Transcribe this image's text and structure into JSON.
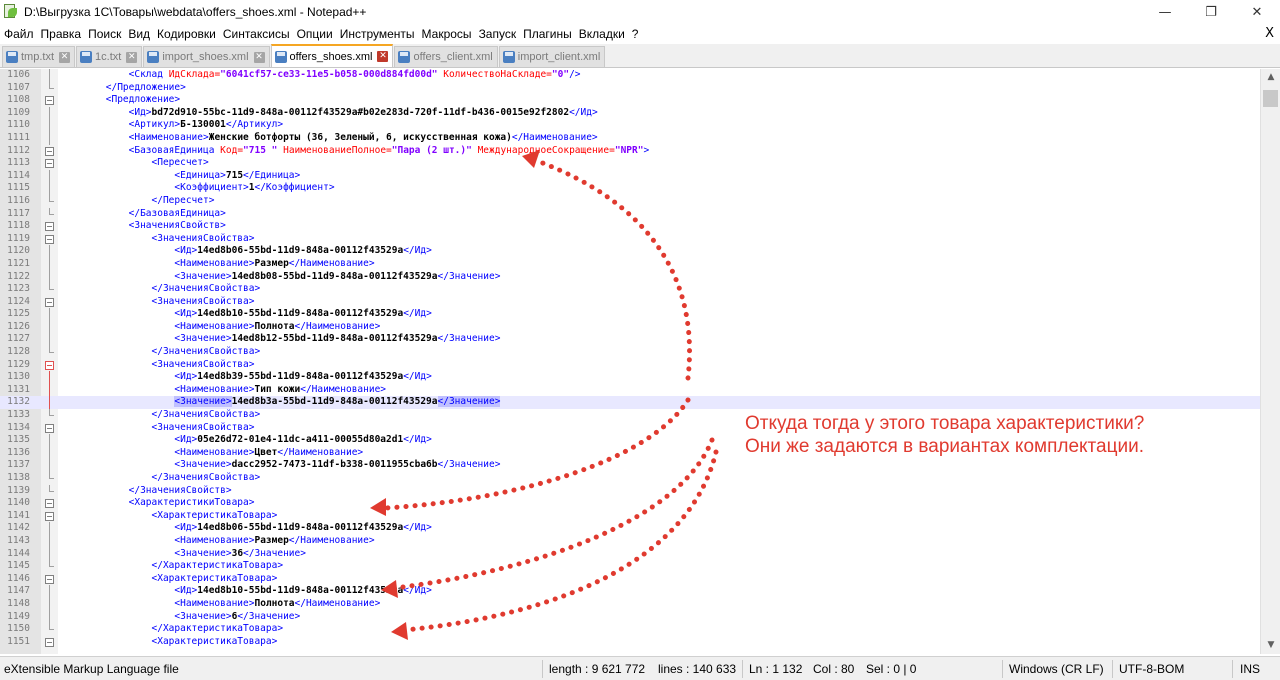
{
  "window": {
    "title": "D:\\Выгрузка 1С\\Товары\\webdata\\offers_shoes.xml - Notepad++",
    "minimize": "—",
    "maximize": "❐",
    "close": "✕"
  },
  "menu": {
    "items": [
      "Файл",
      "Правка",
      "Поиск",
      "Вид",
      "Кодировки",
      "Синтаксисы",
      "Опции",
      "Инструменты",
      "Макросы",
      "Запуск",
      "Плагины",
      "Вкладки",
      "?"
    ],
    "close": "X"
  },
  "tabs": [
    {
      "label": "tmp.txt",
      "active": false
    },
    {
      "label": "1c.txt",
      "active": false
    },
    {
      "label": "import_shoes.xml",
      "active": false
    },
    {
      "label": "offers_shoes.xml",
      "active": true
    },
    {
      "label": "offers_client.xml",
      "active": false
    },
    {
      "label": "import_client.xml",
      "active": false
    }
  ],
  "editor": {
    "current_line": 1132,
    "lines": [
      {
        "n": "1106",
        "indent": 6,
        "parts": [
          [
            "tag",
            "<Склад "
          ],
          [
            "attr",
            "ИдСклада="
          ],
          [
            "val",
            "\"6041cf57-ce33-11e5-b058-000d884fd00d\""
          ],
          [
            "attr",
            " КоличествоНаСкладе="
          ],
          [
            "val",
            "\"0\""
          ],
          [
            "tag",
            "/>"
          ]
        ]
      },
      {
        "n": "1107",
        "indent": 4,
        "parts": [
          [
            "tag",
            "</Предложение>"
          ]
        ]
      },
      {
        "n": "1108",
        "indent": 4,
        "parts": [
          [
            "tag",
            "<Предложение>"
          ]
        ]
      },
      {
        "n": "1109",
        "indent": 6,
        "parts": [
          [
            "tag",
            "<Ид>"
          ],
          [
            "txt",
            "bd72d910-55bc-11d9-848a-00112f43529a#b02e283d-720f-11df-b436-0015e92f2802"
          ],
          [
            "tag",
            "</Ид>"
          ]
        ]
      },
      {
        "n": "1110",
        "indent": 6,
        "parts": [
          [
            "tag",
            "<Артикул>"
          ],
          [
            "txt",
            "Б-130001"
          ],
          [
            "tag",
            "</Артикул>"
          ]
        ]
      },
      {
        "n": "1111",
        "indent": 6,
        "parts": [
          [
            "tag",
            "<Наименование>"
          ],
          [
            "txt",
            "Женские ботфорты (36, Зеленый, 6, искусственная кожа)"
          ],
          [
            "tag",
            "</Наименование>"
          ]
        ]
      },
      {
        "n": "1112",
        "indent": 6,
        "parts": [
          [
            "tag",
            "<БазоваяЕдиница "
          ],
          [
            "attr",
            "Код="
          ],
          [
            "val",
            "\"715 \""
          ],
          [
            "attr",
            " НаименованиеПолное="
          ],
          [
            "val",
            "\"Пара (2 шт.)\""
          ],
          [
            "attr",
            " МеждународноеСокращение="
          ],
          [
            "val",
            "\"NPR\""
          ],
          [
            "tag",
            ">"
          ]
        ]
      },
      {
        "n": "1113",
        "indent": 8,
        "parts": [
          [
            "tag",
            "<Пересчет>"
          ]
        ]
      },
      {
        "n": "1114",
        "indent": 10,
        "parts": [
          [
            "tag",
            "<Единица>"
          ],
          [
            "txt",
            "715"
          ],
          [
            "tag",
            "</Единица>"
          ]
        ]
      },
      {
        "n": "1115",
        "indent": 10,
        "parts": [
          [
            "tag",
            "<Коэффициент>"
          ],
          [
            "txt",
            "1"
          ],
          [
            "tag",
            "</Коэффициент>"
          ]
        ]
      },
      {
        "n": "1116",
        "indent": 8,
        "parts": [
          [
            "tag",
            "</Пересчет>"
          ]
        ]
      },
      {
        "n": "1117",
        "indent": 6,
        "parts": [
          [
            "tag",
            "</БазоваяЕдиница>"
          ]
        ]
      },
      {
        "n": "1118",
        "indent": 6,
        "parts": [
          [
            "tag",
            "<ЗначенияСвойств>"
          ]
        ]
      },
      {
        "n": "1119",
        "indent": 8,
        "parts": [
          [
            "tag",
            "<ЗначенияСвойства>"
          ]
        ]
      },
      {
        "n": "1120",
        "indent": 10,
        "parts": [
          [
            "tag",
            "<Ид>"
          ],
          [
            "txt",
            "14ed8b06-55bd-11d9-848a-00112f43529a"
          ],
          [
            "tag",
            "</Ид>"
          ]
        ]
      },
      {
        "n": "1121",
        "indent": 10,
        "parts": [
          [
            "tag",
            "<Наименование>"
          ],
          [
            "txt",
            "Размер"
          ],
          [
            "tag",
            "</Наименование>"
          ]
        ]
      },
      {
        "n": "1122",
        "indent": 10,
        "parts": [
          [
            "tag",
            "<Значение>"
          ],
          [
            "txt",
            "14ed8b08-55bd-11d9-848a-00112f43529a"
          ],
          [
            "tag",
            "</Значение>"
          ]
        ]
      },
      {
        "n": "1123",
        "indent": 8,
        "parts": [
          [
            "tag",
            "</ЗначенияСвойства>"
          ]
        ]
      },
      {
        "n": "1124",
        "indent": 8,
        "parts": [
          [
            "tag",
            "<ЗначенияСвойства>"
          ]
        ]
      },
      {
        "n": "1125",
        "indent": 10,
        "parts": [
          [
            "tag",
            "<Ид>"
          ],
          [
            "txt",
            "14ed8b10-55bd-11d9-848a-00112f43529a"
          ],
          [
            "tag",
            "</Ид>"
          ]
        ]
      },
      {
        "n": "1126",
        "indent": 10,
        "parts": [
          [
            "tag",
            "<Наименование>"
          ],
          [
            "txt",
            "Полнота"
          ],
          [
            "tag",
            "</Наименование>"
          ]
        ]
      },
      {
        "n": "1127",
        "indent": 10,
        "parts": [
          [
            "tag",
            "<Значение>"
          ],
          [
            "txt",
            "14ed8b12-55bd-11d9-848a-00112f43529a"
          ],
          [
            "tag",
            "</Значение>"
          ]
        ]
      },
      {
        "n": "1128",
        "indent": 8,
        "parts": [
          [
            "tag",
            "</ЗначенияСвойства>"
          ]
        ]
      },
      {
        "n": "1129",
        "indent": 8,
        "parts": [
          [
            "tag",
            "<ЗначенияСвойства>"
          ]
        ]
      },
      {
        "n": "1130",
        "indent": 10,
        "parts": [
          [
            "tag",
            "<Ид>"
          ],
          [
            "txt",
            "14ed8b39-55bd-11d9-848a-00112f43529a"
          ],
          [
            "tag",
            "</Ид>"
          ]
        ]
      },
      {
        "n": "1131",
        "indent": 10,
        "parts": [
          [
            "tag",
            "<Наименование>"
          ],
          [
            "txt",
            "Тип кожи"
          ],
          [
            "tag",
            "</Наименование>"
          ]
        ]
      },
      {
        "n": "1132",
        "indent": 10,
        "parts": [
          [
            "taghl",
            "<Значение>"
          ],
          [
            "txt",
            "14ed8b3a-55bd-11d9-848a-00112f43529a"
          ],
          [
            "taghl",
            "</Значение>"
          ]
        ]
      },
      {
        "n": "1133",
        "indent": 8,
        "parts": [
          [
            "tag",
            "</ЗначенияСвойства>"
          ]
        ]
      },
      {
        "n": "1134",
        "indent": 8,
        "parts": [
          [
            "tag",
            "<ЗначенияСвойства>"
          ]
        ]
      },
      {
        "n": "1135",
        "indent": 10,
        "parts": [
          [
            "tag",
            "<Ид>"
          ],
          [
            "txt",
            "05e26d72-01e4-11dc-a411-00055d80a2d1"
          ],
          [
            "tag",
            "</Ид>"
          ]
        ]
      },
      {
        "n": "1136",
        "indent": 10,
        "parts": [
          [
            "tag",
            "<Наименование>"
          ],
          [
            "txt",
            "Цвет"
          ],
          [
            "tag",
            "</Наименование>"
          ]
        ]
      },
      {
        "n": "1137",
        "indent": 10,
        "parts": [
          [
            "tag",
            "<Значение>"
          ],
          [
            "txt",
            "dacc2952-7473-11df-b338-0011955cba6b"
          ],
          [
            "tag",
            "</Значение>"
          ]
        ]
      },
      {
        "n": "1138",
        "indent": 8,
        "parts": [
          [
            "tag",
            "</ЗначенияСвойства>"
          ]
        ]
      },
      {
        "n": "1139",
        "indent": 6,
        "parts": [
          [
            "tag",
            "</ЗначенияСвойств>"
          ]
        ]
      },
      {
        "n": "1140",
        "indent": 6,
        "parts": [
          [
            "tag",
            "<ХарактеристикиТовара>"
          ]
        ]
      },
      {
        "n": "1141",
        "indent": 8,
        "parts": [
          [
            "tag",
            "<ХарактеристикаТовара>"
          ]
        ]
      },
      {
        "n": "1142",
        "indent": 10,
        "parts": [
          [
            "tag",
            "<Ид>"
          ],
          [
            "txt",
            "14ed8b06-55bd-11d9-848a-00112f43529a"
          ],
          [
            "tag",
            "</Ид>"
          ]
        ]
      },
      {
        "n": "1143",
        "indent": 10,
        "parts": [
          [
            "tag",
            "<Наименование>"
          ],
          [
            "txt",
            "Размер"
          ],
          [
            "tag",
            "</Наименование>"
          ]
        ]
      },
      {
        "n": "1144",
        "indent": 10,
        "parts": [
          [
            "tag",
            "<Значение>"
          ],
          [
            "txt",
            "36"
          ],
          [
            "tag",
            "</Значение>"
          ]
        ]
      },
      {
        "n": "1145",
        "indent": 8,
        "parts": [
          [
            "tag",
            "</ХарактеристикаТовара>"
          ]
        ]
      },
      {
        "n": "1146",
        "indent": 8,
        "parts": [
          [
            "tag",
            "<ХарактеристикаТовара>"
          ]
        ]
      },
      {
        "n": "1147",
        "indent": 10,
        "parts": [
          [
            "tag",
            "<Ид>"
          ],
          [
            "txt",
            "14ed8b10-55bd-11d9-848a-00112f43529a"
          ],
          [
            "tag",
            "</Ид>"
          ]
        ]
      },
      {
        "n": "1148",
        "indent": 10,
        "parts": [
          [
            "tag",
            "<Наименование>"
          ],
          [
            "txt",
            "Полнота"
          ],
          [
            "tag",
            "</Наименование>"
          ]
        ]
      },
      {
        "n": "1149",
        "indent": 10,
        "parts": [
          [
            "tag",
            "<Значение>"
          ],
          [
            "txt",
            "6"
          ],
          [
            "tag",
            "</Значение>"
          ]
        ]
      },
      {
        "n": "1150",
        "indent": 8,
        "parts": [
          [
            "tag",
            "</ХарактеристикаТовара>"
          ]
        ]
      },
      {
        "n": "1151",
        "indent": 8,
        "parts": [
          [
            "tag",
            "<ХарактеристикаТовара>"
          ]
        ]
      }
    ]
  },
  "annotation": {
    "line1": "Откуда тогда у этого товара характеристики?",
    "line2": "Они же задаются в вариантах комплектации.",
    "color": "#e03a2f"
  },
  "statusbar": {
    "filetype": "eXtensible Markup Language file",
    "length": "length : 9 621 772",
    "lines": "lines : 140 633",
    "ln": "Ln : 1 132",
    "col": "Col : 80",
    "sel": "Sel : 0 | 0",
    "eol": "Windows (CR LF)",
    "encoding": "UTF-8-BOM",
    "mode": "INS"
  },
  "colors": {
    "tag": "#0000ff",
    "attribute": "#ff0000",
    "attribute_value": "#8000ff",
    "text": "#000000",
    "current_line": "#e8e8ff",
    "active_tab_accent": "#f5a623"
  }
}
